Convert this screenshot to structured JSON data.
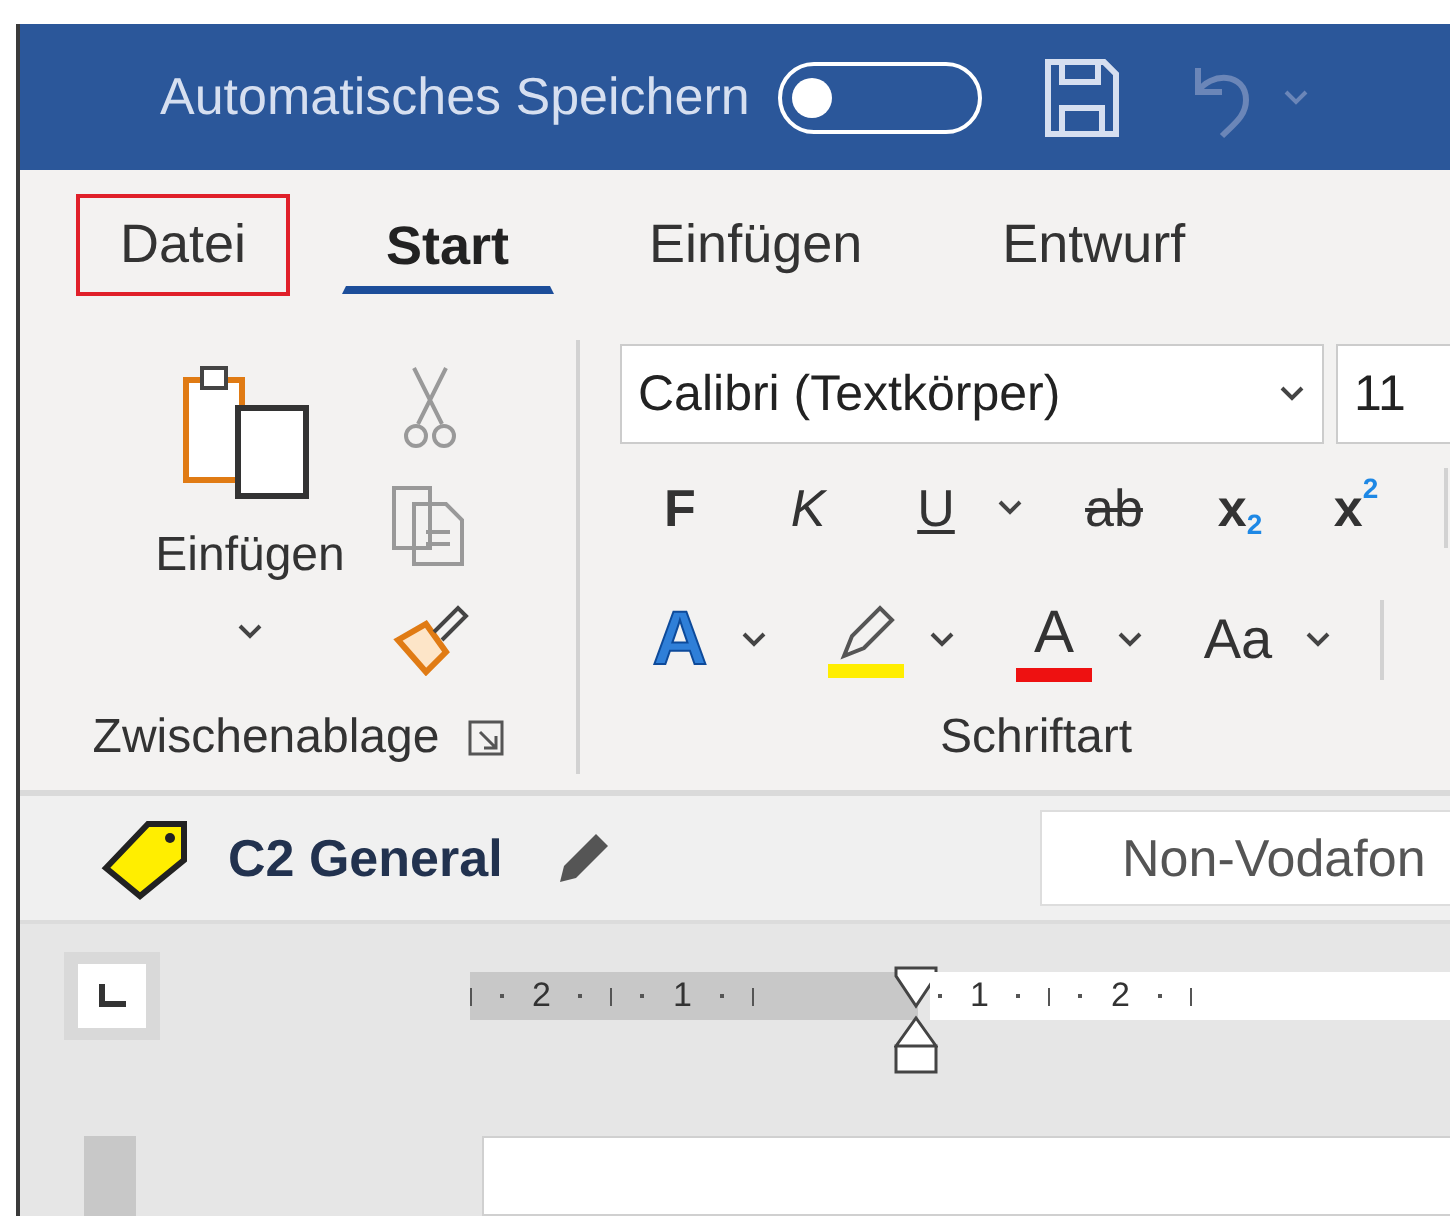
{
  "title_bar": {
    "autosave_label": "Automatisches Speichern",
    "autosave_on": false
  },
  "tabs": [
    {
      "label": "Datei",
      "selected": false,
      "outlined": true
    },
    {
      "label": "Start",
      "selected": true,
      "outlined": false
    },
    {
      "label": "Einfügen",
      "selected": false,
      "outlined": false
    },
    {
      "label": "Entwurf",
      "selected": false,
      "outlined": false
    }
  ],
  "clipboard_group": {
    "paste_label": "Einfügen",
    "group_label": "Zwischenablage"
  },
  "font_group": {
    "font_name": "Calibri (Textkörper)",
    "font_size": "11",
    "bold": "F",
    "italic": "K",
    "underline": "U",
    "strikethrough": "ab",
    "subscript": "x$_{2}$",
    "superscript": "x$^{2}$",
    "text_effects": "A",
    "font_color": "A",
    "change_case": "Aa",
    "group_label": "Schriftart"
  },
  "sensitivity_bar": {
    "label": "C2 General",
    "field_value": "Non-Vodafon"
  },
  "ruler": {
    "left_numbers": [
      "2",
      "1"
    ],
    "right_numbers": [
      "1",
      "2"
    ]
  }
}
